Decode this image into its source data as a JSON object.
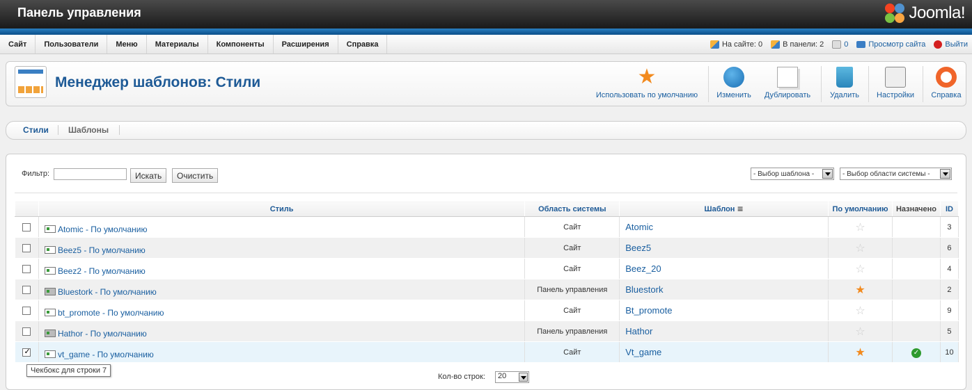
{
  "header": {
    "title": "Панель управления",
    "logo_text": "Joomla!"
  },
  "menu": {
    "items": [
      "Сайт",
      "Пользователи",
      "Меню",
      "Материалы",
      "Компоненты",
      "Расширения",
      "Справка"
    ]
  },
  "status": {
    "on_site": "На сайте: 0",
    "in_panel": "В панели: 2",
    "messages": "0",
    "view_site": "Просмотр сайта",
    "logout": "Выйти"
  },
  "toolbar": {
    "page_title": "Менеджер шаблонов: Стили",
    "default_label": "Использовать по умолчанию",
    "edit_label": "Изменить",
    "duplicate_label": "Дублировать",
    "delete_label": "Удалить",
    "options_label": "Настройки",
    "help_label": "Справка"
  },
  "submenu": {
    "styles": "Стили",
    "templates": "Шаблоны"
  },
  "filter": {
    "label": "Фильтр:",
    "value": "",
    "search_btn": "Искать",
    "clear_btn": "Очистить",
    "template_select": "- Выбор шаблона -",
    "area_select": "- Выбор области системы -"
  },
  "table": {
    "headers": {
      "style": "Стиль",
      "area": "Область системы",
      "template": "Шаблон",
      "default": "По умолчанию",
      "assigned": "Назначено",
      "id": "ID"
    },
    "rows": [
      {
        "style": "Atomic - По умолчанию",
        "area": "Сайт",
        "template": "Atomic",
        "default": false,
        "assigned": false,
        "id": "3",
        "checked": false
      },
      {
        "style": "Beez5 - По умолчанию",
        "area": "Сайт",
        "template": "Beez5",
        "default": false,
        "assigned": false,
        "id": "6",
        "checked": false
      },
      {
        "style": "Beez2 - По умолчанию",
        "area": "Сайт",
        "template": "Beez_20",
        "default": false,
        "assigned": false,
        "id": "4",
        "checked": false
      },
      {
        "style": "Bluestork - По умолчанию",
        "area": "Панель управления",
        "template": "Bluestork",
        "default": true,
        "assigned": false,
        "id": "2",
        "checked": false
      },
      {
        "style": "bt_promote - По умолчанию",
        "area": "Сайт",
        "template": "Bt_promote",
        "default": false,
        "assigned": false,
        "id": "9",
        "checked": false
      },
      {
        "style": "Hathor - По умолчанию",
        "area": "Панель управления",
        "template": "Hathor",
        "default": false,
        "assigned": false,
        "id": "5",
        "checked": false
      },
      {
        "style": "vt_game - По умолчанию",
        "area": "Сайт",
        "template": "Vt_game",
        "default": true,
        "assigned": true,
        "id": "10",
        "checked": true
      }
    ]
  },
  "footer": {
    "rows_label": "Кол-во строк:",
    "rows_value": "20"
  },
  "tooltip": "Чекбокс для строки 7",
  "colors": {
    "accent": "#1e5a96",
    "star": "#f28a1e",
    "header_bg": "#1a1a1a",
    "blue_bar": "#0b4f8a"
  }
}
